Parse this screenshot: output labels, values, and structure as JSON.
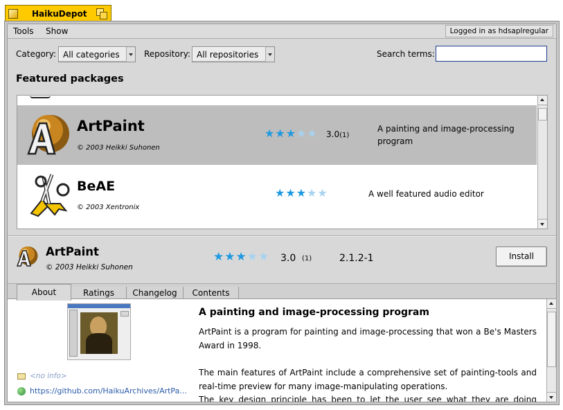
{
  "window": {
    "title": "HaikuDepot"
  },
  "menubar": {
    "items": [
      "Tools",
      "Show"
    ],
    "login_status": "Logged in as hdsaplregular"
  },
  "filters": {
    "category_label": "Category:",
    "category_value": "All categories",
    "repository_label": "Repository:",
    "repository_value": "All repositories",
    "search_label": "Search terms:",
    "search_value": ""
  },
  "featured": {
    "title": "Featured packages",
    "packages": [
      {
        "name": "ArtPaint",
        "copyright": "© 2003 Heikki Suhonen",
        "rating": 3.0,
        "rating_display": "3.0",
        "rating_count": "(1)",
        "description_lines": [
          "A painting and image-processing",
          "program"
        ],
        "selected": true
      },
      {
        "name": "BeAE",
        "copyright": "© 2003 Xentronix",
        "rating": 3.0,
        "rating_display": "",
        "rating_count": "",
        "description_lines": [
          "A well featured audio editor"
        ],
        "selected": false
      }
    ]
  },
  "selected_package": {
    "name": "ArtPaint",
    "copyright": "© 2003 Heikki Suhonen",
    "rating": 3.0,
    "rating_display": "3.0",
    "rating_count": "(1)",
    "version": "2.1.2-1",
    "install_label": "Install"
  },
  "tabs": [
    "About",
    "Ratings",
    "Changelog",
    "Contents"
  ],
  "about": {
    "heading": "A painting and image-processing program",
    "paragraph1": "ArtPaint is a program for painting and image-processing that won a Be's Masters Award in 1998.",
    "paragraph2": "The main features of ArtPaint include a comprehensive set of painting-tools and real-time preview for many image-manipulating operations.",
    "paragraph3": "The key design principle has been to let the user see what they are doing instead of just",
    "email": "<no info>",
    "website": "https://github.com/HaikuArchives/ArtPa..."
  },
  "colors": {
    "tab_yellow": "#ffcb00",
    "star_on": "#1f9ae0",
    "star_off": "#a8d3f0",
    "selection": "#bdbdbd",
    "search_border": "#1c3d8f"
  }
}
